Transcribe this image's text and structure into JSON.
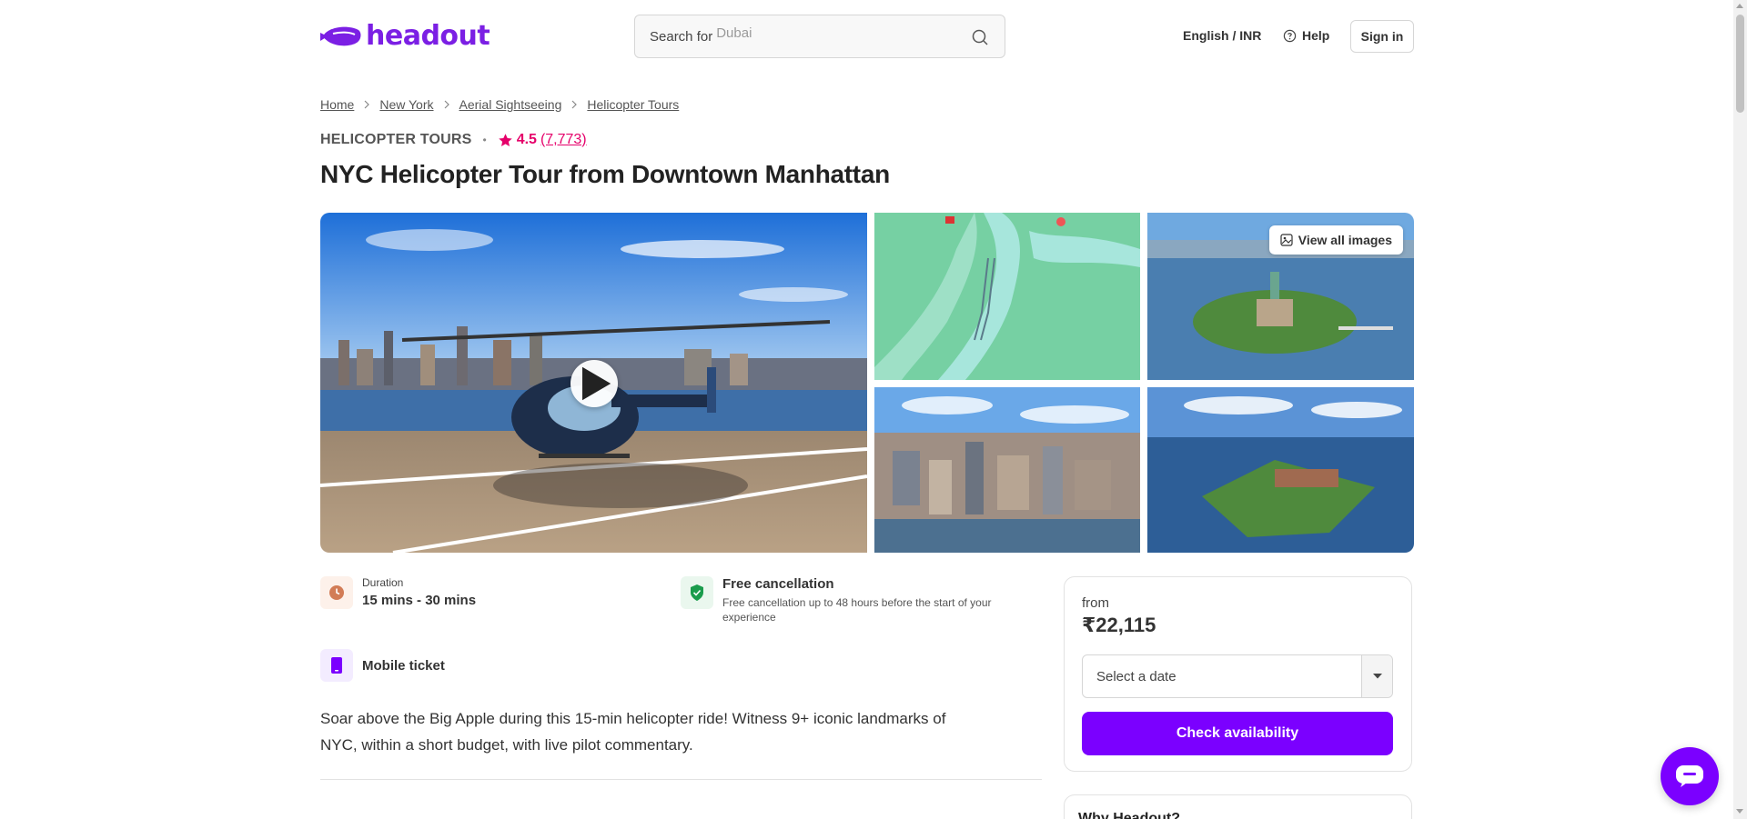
{
  "header": {
    "logo_text": "headout",
    "search_label": "Search for",
    "search_placeholder": "Dubai",
    "language_currency": "English / INR",
    "help_label": "Help",
    "signin_label": "Sign in"
  },
  "breadcrumb": [
    "Home",
    "New York",
    "Aerial Sightseeing",
    "Helicopter Tours"
  ],
  "product": {
    "category": "HELICOPTER TOURS",
    "rating": "4.5",
    "review_count": "(7,773)",
    "title": "NYC Helicopter Tour from Downtown Manhattan"
  },
  "gallery": {
    "view_all_label": "View all images"
  },
  "features": {
    "duration_label": "Duration",
    "duration_value": "15 mins - 30 mins",
    "cancellation_title": "Free cancellation",
    "cancellation_desc": "Free cancellation up to 48 hours before the start of your experience",
    "ticket_title": "Mobile ticket"
  },
  "description": "Soar above the Big Apple during this 15-min helicopter ride! Witness 9+ iconic landmarks of NYC, within a short budget, with live pilot commentary.",
  "booking": {
    "from_label": "from",
    "price": "₹22,115",
    "date_placeholder": "Select a date",
    "check_label": "Check availability"
  },
  "why_card": {
    "title": "Why Headout?"
  },
  "colors": {
    "brand_purple": "#7b00ff",
    "rating_pink": "#e5006a",
    "logo_purple": "#7b1fe4"
  }
}
